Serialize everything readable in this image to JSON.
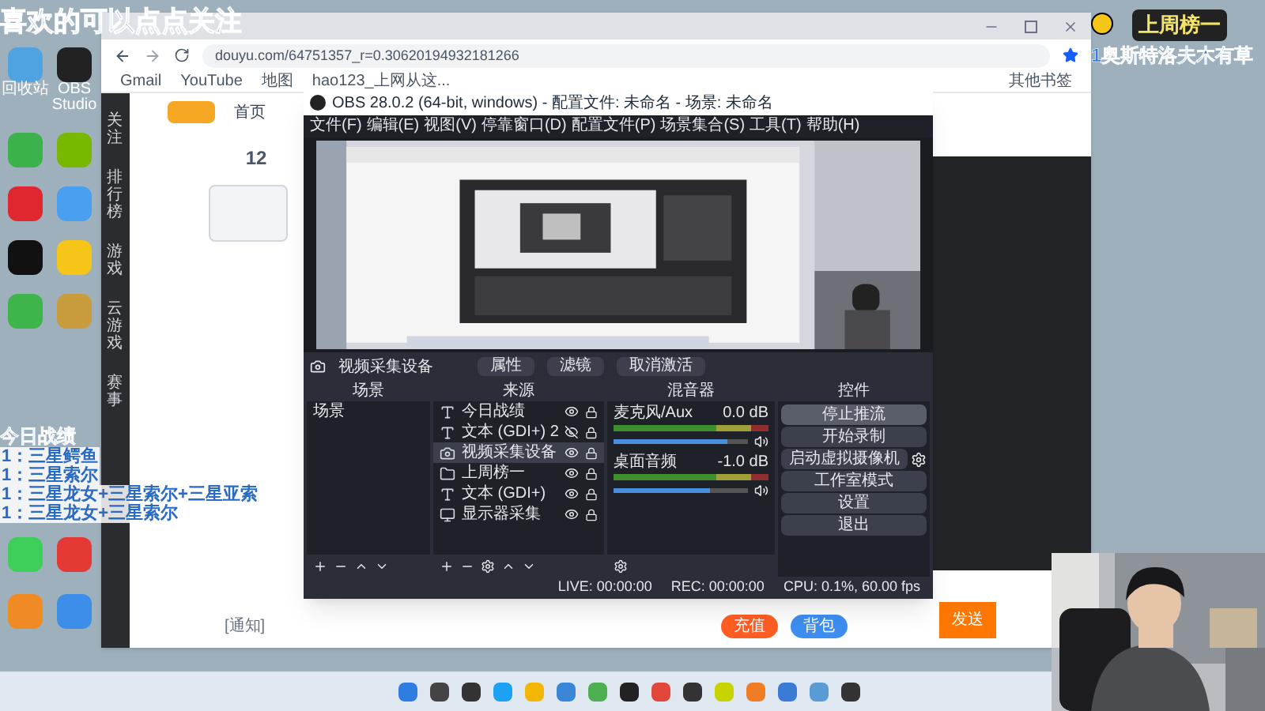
{
  "overlays": {
    "follow_banner": "喜欢的可以点点关注",
    "weekly_top": {
      "title": "上周榜一",
      "name": "1奥斯特洛夫木有草"
    },
    "today_record": {
      "title": "今日战绩",
      "lines": [
        "1：三星鳄鱼",
        "1：三星索尔",
        "1：三星龙女+三星索尔+三星亚索",
        "1：三星龙女+三星索尔"
      ]
    }
  },
  "desktop_icons": [
    {
      "label": "回收站"
    },
    {
      "label": "OBS Studio"
    }
  ],
  "browser": {
    "url": "douyu.com/64751357_r=0.30620194932181266",
    "bookmarks": [
      "Gmail",
      "YouTube",
      "地图",
      "hao123_上网从这..."
    ],
    "other_bookmarks": "其他书签",
    "page": {
      "nav_home": "首页",
      "score": "12",
      "sidebar": [
        "关注",
        "排行榜",
        "游戏",
        "云游戏",
        "赛事"
      ],
      "notice": "[通知]",
      "recharge": "充值",
      "bag": "背包",
      "send": "发送"
    }
  },
  "obs": {
    "title": "OBS 28.0.2 (64-bit, windows) - 配置文件: 未命名 - 场景: 未命名",
    "menu": [
      "文件(F)",
      "编辑(E)",
      "视图(V)",
      "停靠窗口(D)",
      "配置文件(P)",
      "场景集合(S)",
      "工具(T)",
      "帮助(H)"
    ],
    "source_label": "视频采集设备",
    "toolbar": [
      "属性",
      "滤镜",
      "取消激活"
    ],
    "scenes": {
      "title": "场景",
      "items": [
        "场景"
      ]
    },
    "sources": {
      "title": "来源",
      "items": [
        {
          "name": "今日战绩",
          "kind": "text",
          "visible": true,
          "selected": false
        },
        {
          "name": "文本 (GDI+) 2",
          "kind": "text",
          "visible": false,
          "selected": false
        },
        {
          "name": "视频采集设备",
          "kind": "camera",
          "visible": true,
          "selected": true
        },
        {
          "name": "上周榜一",
          "kind": "group",
          "visible": true,
          "selected": false
        },
        {
          "name": "文本 (GDI+)",
          "kind": "text",
          "visible": true,
          "selected": false
        },
        {
          "name": "显示器采集",
          "kind": "display",
          "visible": true,
          "selected": false
        }
      ]
    },
    "mixer": {
      "title": "混音器",
      "channels": [
        {
          "name": "麦克风/Aux",
          "reading": "0.0 dB",
          "level": 0.85
        },
        {
          "name": "桌面音频",
          "reading": "-1.0 dB",
          "level": 0.72
        }
      ]
    },
    "controls": {
      "title": "控件",
      "buttons": [
        {
          "label": "停止推流",
          "kind": "plain"
        },
        {
          "label": "开始录制",
          "kind": "plain"
        },
        {
          "label": "启动虚拟摄像机",
          "kind": "gear"
        },
        {
          "label": "工作室模式",
          "kind": "plain"
        },
        {
          "label": "设置",
          "kind": "plain"
        },
        {
          "label": "退出",
          "kind": "plain"
        }
      ]
    },
    "status": {
      "live": "LIVE: 00:00:00",
      "rec": "REC: 00:00:00",
      "cpu": "CPU: 0.1%, 60.00 fps"
    }
  }
}
